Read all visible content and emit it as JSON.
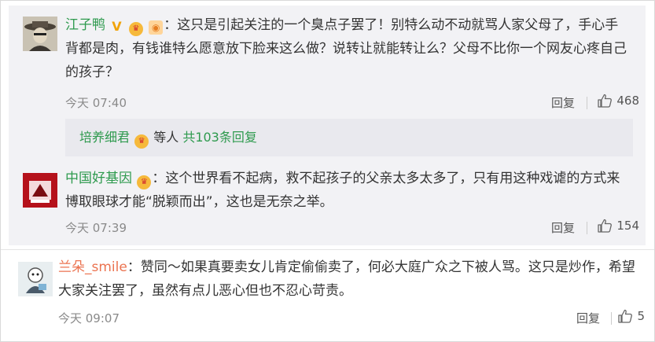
{
  "colors": {
    "username_green": "#2e9a4e",
    "username_orange": "#eb7350",
    "panel_bg": "#f2f2f5",
    "subreply_bg": "#e9e9ee"
  },
  "comments": [
    {
      "username": "江子鸭",
      "badges": [
        "vip-v-icon",
        "crown-icon",
        "level-icon"
      ],
      "text": "：这只是引起关注的一个臭点子罢了！别特么动不动就骂人家父母了，手心手背都是肉，有钱谁特么愿意放下脸来这么做？说转让就能转让么？父母不比你一个网友心疼自己的孩子？",
      "time": "今天 07:40",
      "reply_label": "回复",
      "likes": "468",
      "subreplies": {
        "name": "培养细君",
        "middle": "等人",
        "count_label": "共103条回复"
      }
    },
    {
      "username": "中国好基因",
      "badges": [
        "crown-icon"
      ],
      "text": "：这个世界看不起病，救不起孩子的父亲太多太多了，只有用这种戏谑的方式来博取眼球才能“脱颖而出”，这也是无奈之举。",
      "time": "今天 07:39",
      "reply_label": "回复",
      "likes": "154"
    },
    {
      "username": "兰朵_smile",
      "text": "：赞同～如果真要卖女儿肯定偷偷卖了，何必大庭广众之下被人骂。这只是炒作，希望大家关注罢了，虽然有点儿恶心但也不忍心苛责。",
      "time": "今天 09:07",
      "reply_label": "回复",
      "likes": "5"
    }
  ]
}
